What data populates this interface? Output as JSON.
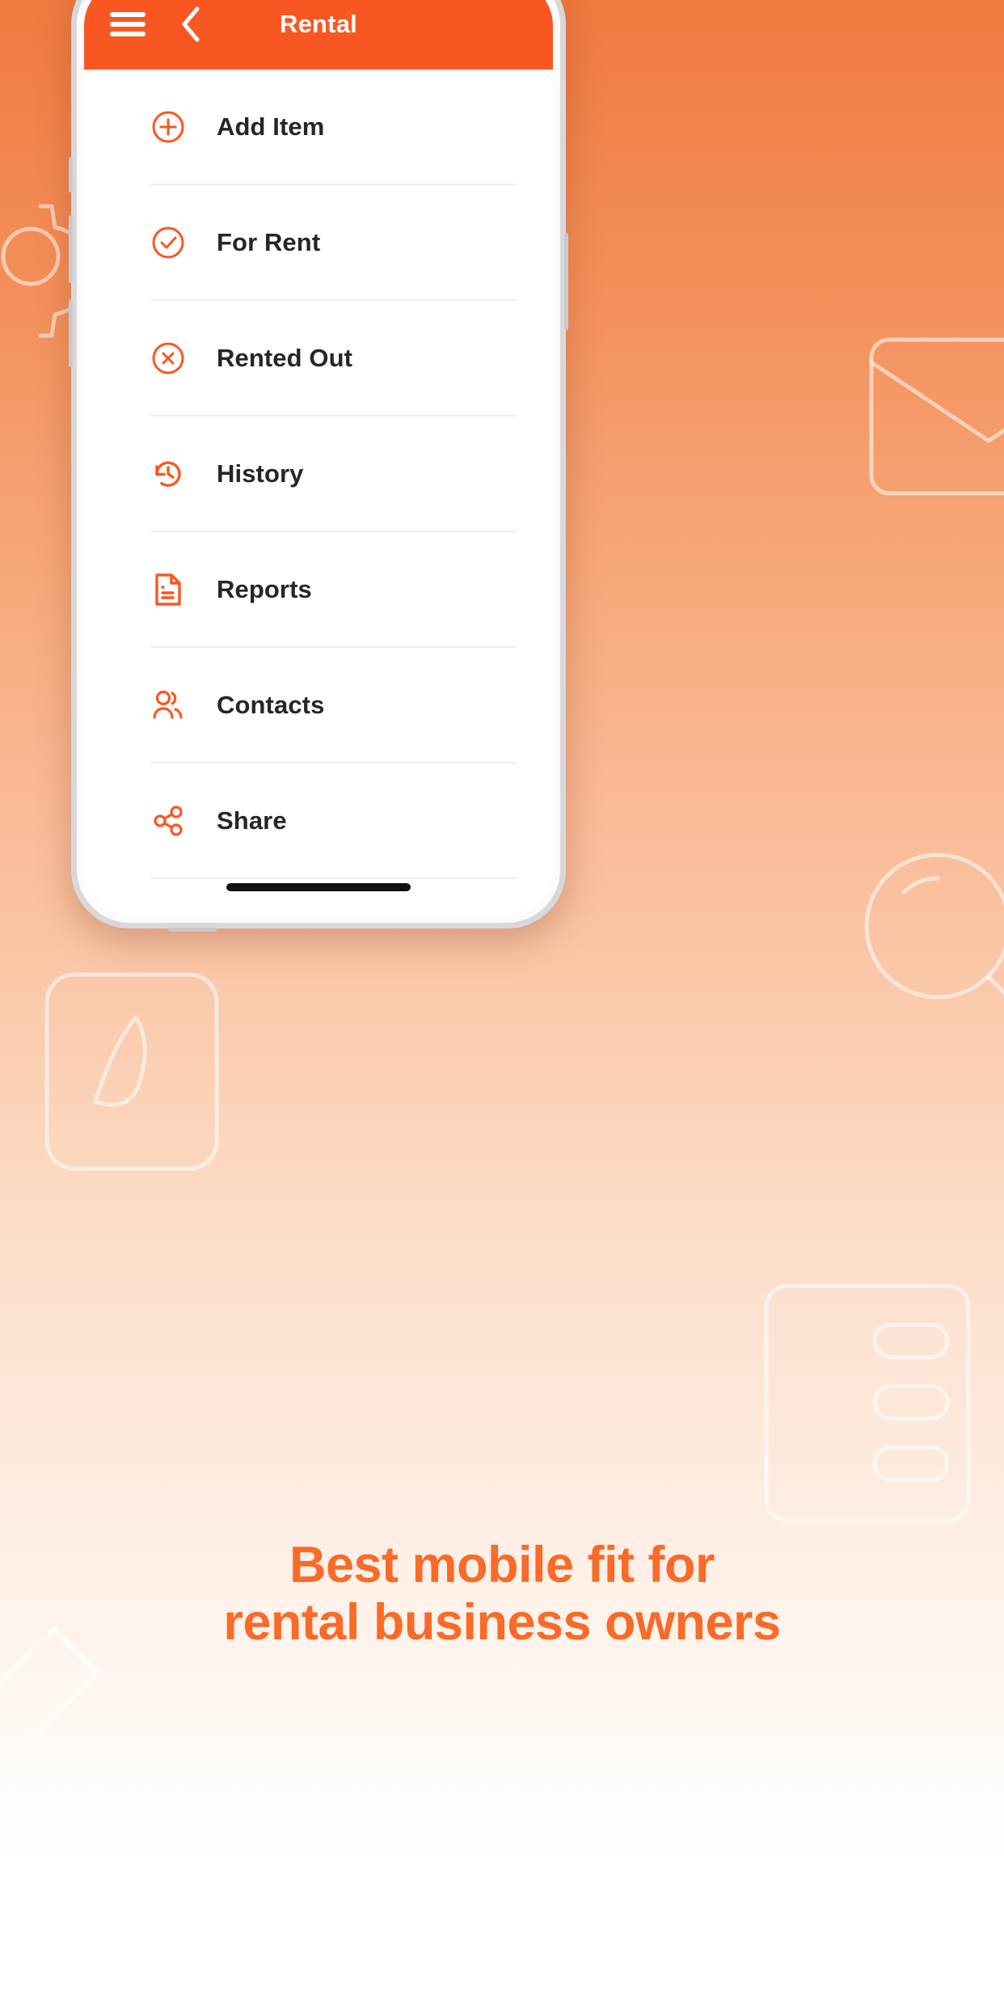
{
  "background": {
    "gradient_top": "#f07a3f",
    "gradient_bottom": "#ffffff",
    "ornaments": [
      "gear-outline",
      "envelope-outline",
      "magnifier-outline",
      "pen-outline",
      "pencil-outline",
      "list-card-outline"
    ]
  },
  "app": {
    "header": {
      "title": "Rental",
      "background_color": "#f95721",
      "title_color": "#ffffff",
      "menu_icon": "hamburger-icon",
      "back_icon": "chevron-left-icon"
    },
    "accent_color": "#f95721",
    "menu": {
      "items": [
        {
          "label": "Add Item",
          "icon": "circle-plus-icon"
        },
        {
          "label": "For Rent",
          "icon": "circle-check-icon"
        },
        {
          "label": "Rented Out",
          "icon": "circle-x-icon"
        },
        {
          "label": "History",
          "icon": "clock-rotate-left-icon"
        },
        {
          "label": "Reports",
          "icon": "document-lines-icon"
        },
        {
          "label": "Contacts",
          "icon": "users-icon"
        },
        {
          "label": "Share",
          "icon": "share-nodes-icon"
        }
      ]
    }
  },
  "tagline": {
    "line1": "Best mobile fit for",
    "line2": "rental business owners",
    "color": "#fa6a28"
  }
}
